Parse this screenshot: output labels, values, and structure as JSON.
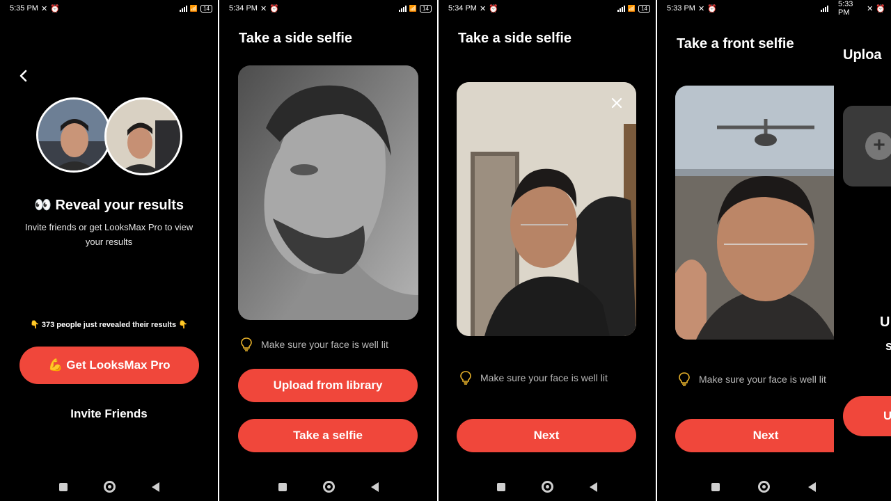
{
  "screens": [
    {
      "status_time": "5:35 PM",
      "battery": "14",
      "reveal_title": "👀 Reveal your results",
      "subtitle": "Invite friends or get LooksMax Pro to view your results",
      "people_note": "👇 373 people just revealed their results 👇",
      "pro_button": "💪 Get LooksMax Pro",
      "invite_button": "Invite Friends"
    },
    {
      "status_time": "5:34 PM",
      "battery": "14",
      "title": "Take a side selfie",
      "tip": "Make sure your face is well lit",
      "upload_button": "Upload from library",
      "selfie_button": "Take a selfie"
    },
    {
      "status_time": "5:34 PM",
      "battery": "14",
      "title": "Take a side selfie",
      "tip": "Make sure your face is well lit",
      "next_button": "Next"
    },
    {
      "status_time": "5:33 PM",
      "title": "Take a front selfie",
      "tip": "Make sure your face is well lit",
      "next_button": "Next"
    },
    {
      "status_time": "5:33 PM",
      "title": "Uploa",
      "text_fragment_1": "U",
      "text_fragment_2": "s",
      "button_fragment": "U"
    }
  ],
  "colors": {
    "accent": "#f0473b",
    "background": "#000000",
    "tip_icon": "#e8b22a"
  },
  "icons": [
    "back-arrow-icon",
    "eyes-emoji",
    "bulb-icon",
    "close-icon",
    "plus-icon",
    "home-icon",
    "recents-icon",
    "back-icon"
  ]
}
